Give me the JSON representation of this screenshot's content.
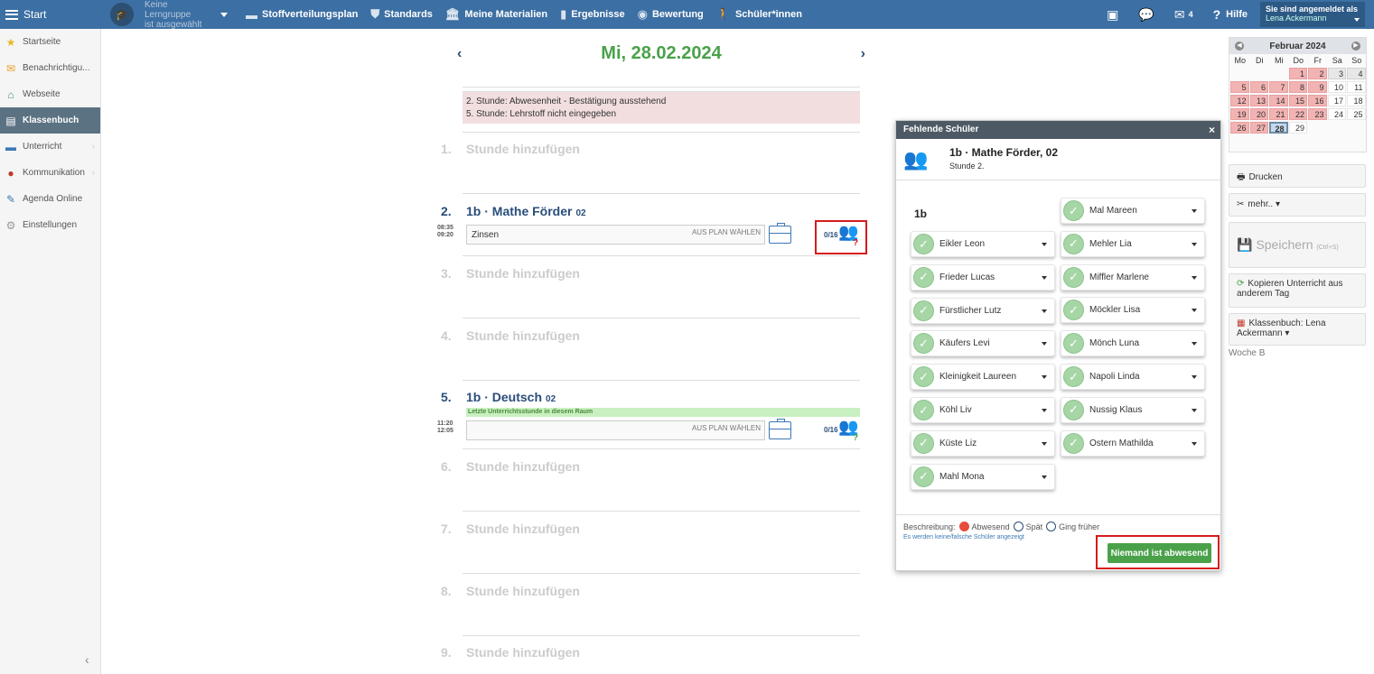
{
  "topbar": {
    "start": "Start",
    "group_line1": "Keine Lerngruppe",
    "group_line2": "ist ausgewählt",
    "nav": [
      "Stoffverteilungsplan",
      "Standards",
      "Meine Materialien",
      "Ergebnisse",
      "Bewertung",
      "Schüler*innen"
    ],
    "mail_count": "4",
    "help": "Hilfe",
    "user_label": "Sie sind angemeldet als",
    "user_name": "Lena Ackermann"
  },
  "sidebar": {
    "items": [
      {
        "label": "Startseite",
        "icon": "star-icon"
      },
      {
        "label": "Benachrichtigu...",
        "icon": "envelope-icon"
      },
      {
        "label": "Webseite",
        "icon": "house-icon"
      },
      {
        "label": "Klassenbuch",
        "icon": "book-icon"
      },
      {
        "label": "Unterricht",
        "icon": "briefcase-icon"
      },
      {
        "label": "Kommunikation",
        "icon": "chat-icon"
      },
      {
        "label": "Agenda Online",
        "icon": "pencil-icon"
      },
      {
        "label": "Einstellungen",
        "icon": "gear-icon"
      }
    ]
  },
  "main": {
    "date": "Mi, 28.02.2024",
    "warnings": [
      "2. Stunde: Abwesenheit - Bestätigung ausstehend",
      "5. Stunde: Lehrstoff nicht eingegeben"
    ],
    "add_lesson": "Stunde hinzufügen",
    "plan_choose": "AUS PLAN WÄHLEN",
    "lesson2": {
      "num": "2.",
      "title": "1b · Mathe Förder",
      "room": "02",
      "start": "08:35",
      "end": "09:20",
      "topic": "Zinsen",
      "absent": "0/16",
      "mark": "?"
    },
    "lesson5": {
      "num": "5.",
      "title": "1b · Deutsch",
      "room": "02",
      "start": "11:20",
      "end": "12:05",
      "topic": "",
      "info": "Letzte Unterrichtsstunde in diesem Raum",
      "absent": "0/16",
      "mark": "?"
    },
    "empty_nums": [
      "1.",
      "3.",
      "4.",
      "6.",
      "7.",
      "8.",
      "9."
    ]
  },
  "modal": {
    "title": "Fehlende Schüler",
    "subject": "1b · Mathe Förder, 02",
    "lesson": "Stunde 2.",
    "class": "1b",
    "students_left": [
      "Eikler Leon",
      "Frieder Lucas",
      "Fürstlicher Lutz",
      "Käufers Levi",
      "Kleinigkeit Laureen",
      "Köhl Liv",
      "Küste Liz",
      "Mahl Mona"
    ],
    "students_right": [
      "Mal Mareen",
      "Mehler Lia",
      "Miffler Marlene",
      "Möckler Lisa",
      "Mönch Luna",
      "Napoli Linda",
      "Nussig Klaus",
      "Ostern Mathilda"
    ],
    "legend_label": "Beschreibung:",
    "legend_absent": "Abwesend",
    "legend_late": "Spät",
    "legend_early": "Ging früher",
    "wrong_link": "Es werden keine/falsche Schüler angezeigt",
    "nobody_button": "Niemand ist abwesend"
  },
  "calendar": {
    "month": "Februar 2024",
    "dow": [
      "Mo",
      "Di",
      "Mi",
      "Do",
      "Fr",
      "Sa",
      "So"
    ],
    "days": [
      {
        "d": "",
        "s": "empty"
      },
      {
        "d": "",
        "s": "empty"
      },
      {
        "d": "",
        "s": "empty"
      },
      {
        "d": "1",
        "s": "red"
      },
      {
        "d": "2",
        "s": "red"
      },
      {
        "d": "3",
        "s": "grey"
      },
      {
        "d": "4",
        "s": "grey"
      },
      {
        "d": "5",
        "s": "red"
      },
      {
        "d": "6",
        "s": "red"
      },
      {
        "d": "7",
        "s": "red"
      },
      {
        "d": "8",
        "s": "red"
      },
      {
        "d": "9",
        "s": "red"
      },
      {
        "d": "10",
        "s": "plain"
      },
      {
        "d": "11",
        "s": "plain"
      },
      {
        "d": "12",
        "s": "red"
      },
      {
        "d": "13",
        "s": "red"
      },
      {
        "d": "14",
        "s": "red"
      },
      {
        "d": "15",
        "s": "red"
      },
      {
        "d": "16",
        "s": "red"
      },
      {
        "d": "17",
        "s": "plain"
      },
      {
        "d": "18",
        "s": "plain"
      },
      {
        "d": "19",
        "s": "red"
      },
      {
        "d": "20",
        "s": "red"
      },
      {
        "d": "21",
        "s": "red"
      },
      {
        "d": "22",
        "s": "red"
      },
      {
        "d": "23",
        "s": "red"
      },
      {
        "d": "24",
        "s": "plain"
      },
      {
        "d": "25",
        "s": "plain"
      },
      {
        "d": "26",
        "s": "red"
      },
      {
        "d": "27",
        "s": "red"
      },
      {
        "d": "28",
        "s": "today"
      },
      {
        "d": "29",
        "s": "plain"
      }
    ]
  },
  "right_panel": {
    "print": "Drucken",
    "more": "mehr.. ▾",
    "save": "Speichern",
    "save_hint": "(Ctrl+S)",
    "copy": "Kopieren Unterricht aus anderem Tag",
    "classbook": "Klassenbuch: Lena Ackermann ▾",
    "week": "Woche B"
  },
  "colors": {
    "topbar": "#3c6fa3",
    "accent_green": "#4aa14a",
    "title_blue": "#2a4d7a",
    "alert_red": "#d51c1c"
  }
}
